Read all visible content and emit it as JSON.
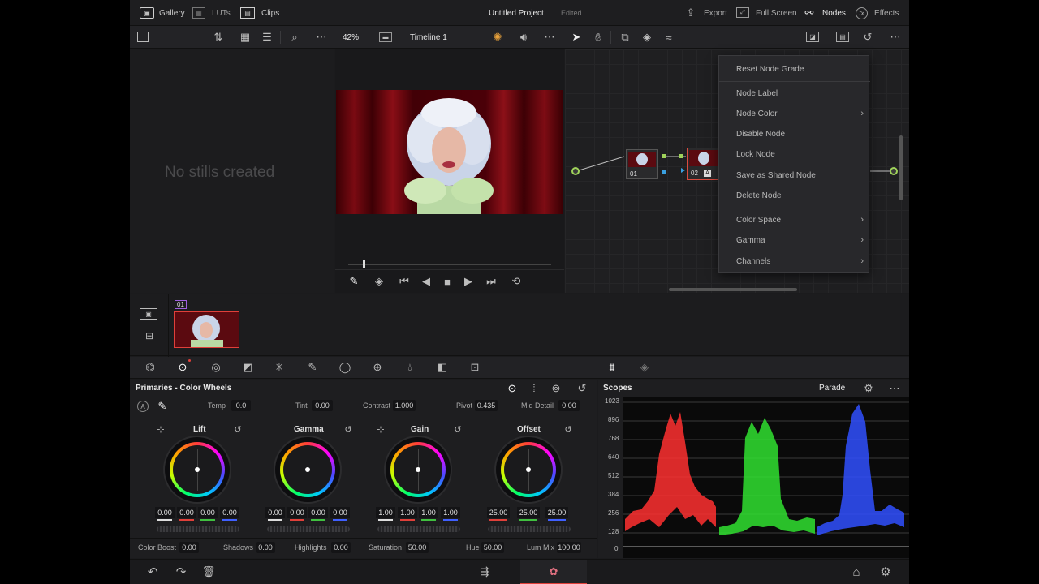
{
  "topbar": {
    "gallery": "Gallery",
    "luts": "LUTs",
    "clips": "Clips",
    "project_title": "Untitled Project",
    "project_status": "Edited",
    "export": "Export",
    "fullscreen": "Full Screen",
    "nodes": "Nodes",
    "effects": "Effects"
  },
  "toolbar": {
    "zoom": "42%",
    "timeline": "Timeline 1"
  },
  "gallery": {
    "empty_text": "No stills created"
  },
  "nodes": {
    "node1_label": "01",
    "node2_label": "02",
    "node2_badge": "A"
  },
  "context_menu": {
    "items": [
      "Reset Node Grade",
      "Node Label",
      "Node Color",
      "Disable Node",
      "Lock Node",
      "Save as Shared Node",
      "Delete Node",
      "Color Space",
      "Gamma",
      "Channels"
    ]
  },
  "clip": {
    "number": "01"
  },
  "primaries": {
    "title": "Primaries - Color Wheels",
    "temp_label": "Temp",
    "temp_value": "0.0",
    "tint_label": "Tint",
    "tint_value": "0.00",
    "contrast_label": "Contrast",
    "contrast_value": "1.000",
    "pivot_label": "Pivot",
    "pivot_value": "0.435",
    "middetail_label": "Mid Detail",
    "middetail_value": "0.00",
    "auto_label": "A",
    "wheels": [
      {
        "label": "Lift",
        "values": [
          "0.00",
          "0.00",
          "0.00",
          "0.00"
        ]
      },
      {
        "label": "Gamma",
        "values": [
          "0.00",
          "0.00",
          "0.00",
          "0.00"
        ]
      },
      {
        "label": "Gain",
        "values": [
          "1.00",
          "1.00",
          "1.00",
          "1.00"
        ]
      },
      {
        "label": "Offset",
        "values": [
          "25.00",
          "25.00",
          "25.00"
        ]
      }
    ],
    "colorboost_label": "Color Boost",
    "colorboost_value": "0.00",
    "shadows_label": "Shadows",
    "shadows_value": "0.00",
    "highlights_label": "Highlights",
    "highlights_value": "0.00",
    "saturation_label": "Saturation",
    "saturation_value": "50.00",
    "hue_label": "Hue",
    "hue_value": "50.00",
    "lummix_label": "Lum Mix",
    "lummix_value": "100.00"
  },
  "scopes": {
    "title": "Scopes",
    "mode": "Parade",
    "scale": [
      "1023",
      "896",
      "768",
      "640",
      "512",
      "384",
      "256",
      "128",
      "0"
    ]
  },
  "colors": {
    "accent_red": "#e0403a",
    "selection_red": "#d94b3f",
    "scope_red": "#ff4040",
    "scope_green": "#40ff40",
    "scope_blue": "#4060ff"
  }
}
